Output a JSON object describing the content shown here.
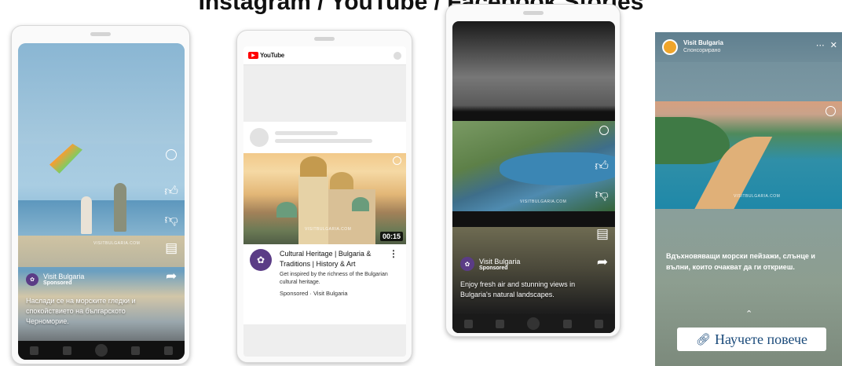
{
  "header": {
    "title": "Instagram / YouTube / Facebook Stories"
  },
  "phone1": {
    "watermark": "VISITBULGARIA.COM",
    "channel": "Visit Bulgaria",
    "sponsored": "Sponsored",
    "caption": "Наслади се на морските гледки и спокойствието на българското Черноморие.",
    "icons": [
      "thumbs-up-icon",
      "thumbs-down-icon",
      "comment-icon",
      "share-icon"
    ]
  },
  "phone2": {
    "app_name": "YouTube",
    "duration": "00:15",
    "watermark": "VISITBULGARIA.COM",
    "title": "Cultural Heritage | Bulgaria & Traditions | History & Art",
    "description": "Get inspired by the richness of the Bulgarian cultural heritage.",
    "sponsored_line": "Sponsored · Visit Bulgaria"
  },
  "phone3": {
    "watermark": "VISITBULGARIA.COM",
    "channel": "Visit Bulgaria",
    "sponsored": "Sponsored",
    "caption": "Enjoy fresh air and stunning views in Bulgaria's natural landscapes."
  },
  "phone4": {
    "account": "Visit Bulgaria",
    "subtitle": "Спонсорирано",
    "watermark": "VISITBULGARIA.COM",
    "caption": "Вдъхновяващи морски пейзажи, слънце и вълни, които очакват да ги откриеш.",
    "cta_label": "Научете повече"
  },
  "colors": {
    "brand_purple": "#5b3c86",
    "youtube_red": "#ff0000",
    "cta_text": "#1a4a7a"
  }
}
